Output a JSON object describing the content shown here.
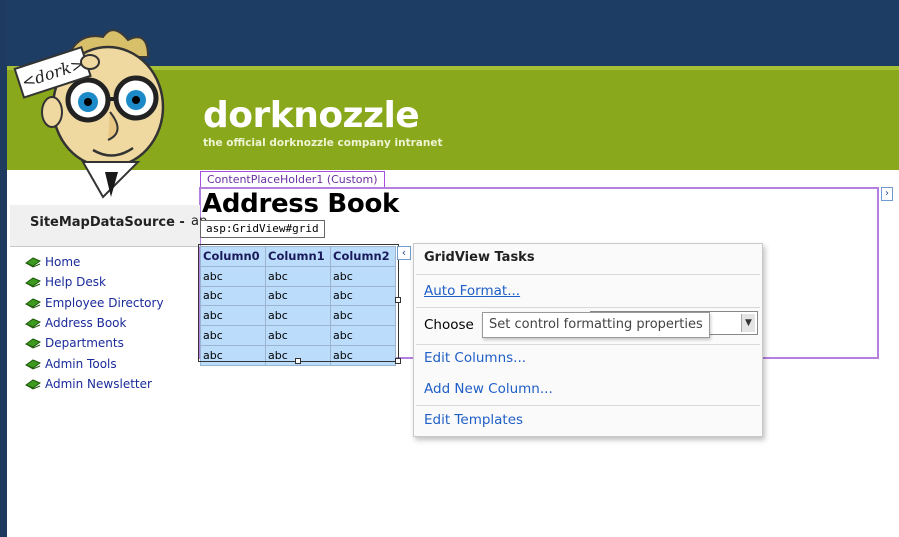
{
  "header": {
    "brand": "dorknozzle",
    "tagline": "the official dorknozzle company intranet",
    "logo_sign": "<dork>"
  },
  "content_placeholder": {
    "tab_label": "ContentPlaceHolder1 (Custom)"
  },
  "page": {
    "title": "Address Book"
  },
  "sitemap": {
    "label": "SiteMapDataSource - ",
    "label_ext": "ap",
    "items": [
      {
        "label": "Home"
      },
      {
        "label": "Help Desk"
      },
      {
        "label": "Employee Directory"
      },
      {
        "label": "Address Book"
      },
      {
        "label": "Departments"
      },
      {
        "label": "Admin Tools"
      },
      {
        "label": "Admin Newsletter"
      }
    ]
  },
  "gridview": {
    "tag": "asp:GridView#grid",
    "columns": [
      "Column0",
      "Column1",
      "Column2"
    ],
    "rows": [
      [
        "abc",
        "abc",
        "abc"
      ],
      [
        "abc",
        "abc",
        "abc"
      ],
      [
        "abc",
        "abc",
        "abc"
      ],
      [
        "abc",
        "abc",
        "abc"
      ],
      [
        "abc",
        "abc",
        "abc"
      ]
    ]
  },
  "tasks": {
    "title": "GridView Tasks",
    "auto_format": "Auto Format...",
    "choose_label": "Choose",
    "tooltip": "Set control formatting properties",
    "edit_columns": "Edit Columns...",
    "add_column": "Add New Column...",
    "edit_templates": "Edit Templates"
  },
  "colors": {
    "header_dark": "#1e3d64",
    "header_green": "#8aa81c",
    "link": "#1f5fc7",
    "placeholder_border": "#b57fe0",
    "grid_bg": "#bcdcfb"
  }
}
